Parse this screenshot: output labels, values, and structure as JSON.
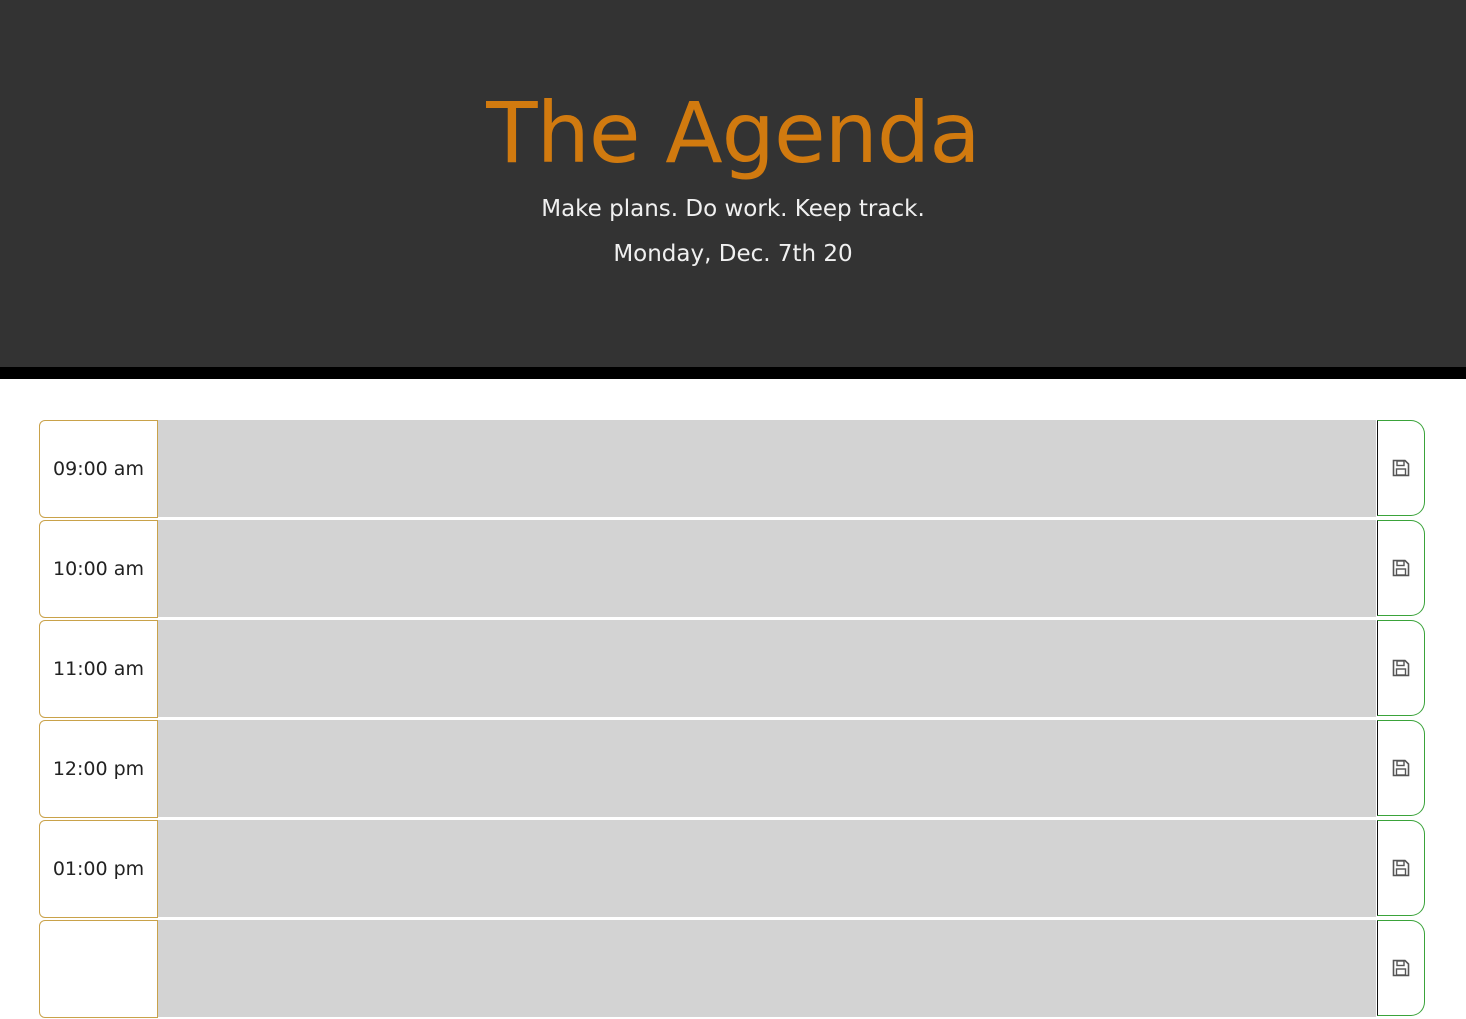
{
  "header": {
    "title": "The Agenda",
    "tagline": "Make plans. Do work. Keep track.",
    "date": "Monday, Dec. 7th 20"
  },
  "timeblocks": [
    {
      "hour": "09:00 am",
      "text": ""
    },
    {
      "hour": "10:00 am",
      "text": ""
    },
    {
      "hour": "11:00 am",
      "text": ""
    },
    {
      "hour": "12:00 pm",
      "text": ""
    },
    {
      "hour": "01:00 pm",
      "text": ""
    },
    {
      "hour": "",
      "text": ""
    }
  ],
  "colors": {
    "title": "#d17a0f",
    "header_bg": "#333333",
    "row_bg": "#d3d3d3",
    "hour_border": "#c9a24a",
    "save_border": "#3aa33a"
  },
  "icons": {
    "save": "floppy-disk-icon"
  }
}
